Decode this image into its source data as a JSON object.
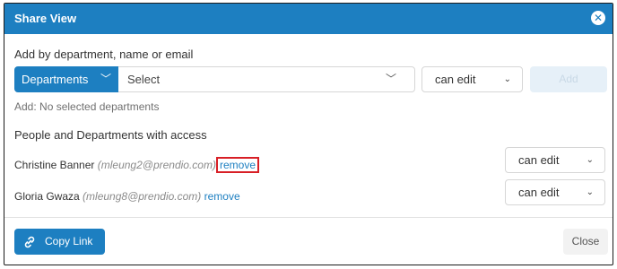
{
  "dialog": {
    "title": "Share View",
    "close_icon": "close-icon"
  },
  "add_section": {
    "label": "Add by department, name or email",
    "type_button": "Departments",
    "select_placeholder": "Select",
    "permission": "can edit",
    "add_button": "Add",
    "add_prefix": "Add:",
    "add_status": "No selected departments"
  },
  "access_section": {
    "label": "People and Departments with access",
    "people": [
      {
        "name": "Christine Banner",
        "email": "(mleung2@prendio.com)",
        "remove_label": "remove",
        "permission": "can edit"
      },
      {
        "name": "Gloria Gwaza",
        "email": "(mleung8@prendio.com)",
        "remove_label": "remove",
        "permission": "can edit"
      }
    ]
  },
  "footer": {
    "copy_link": "Copy Link",
    "close": "Close"
  },
  "colors": {
    "accent": "#1d7fc1",
    "highlight": "#d81f26"
  }
}
